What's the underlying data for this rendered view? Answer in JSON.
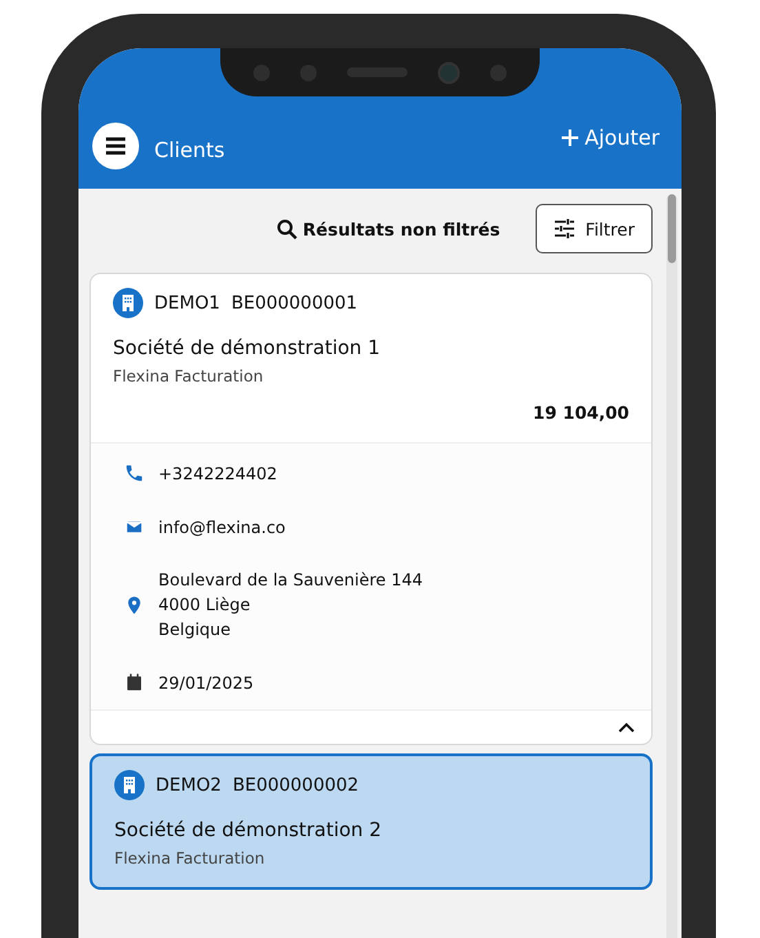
{
  "header": {
    "title": "Clients",
    "add_label": "Ajouter"
  },
  "toolbar": {
    "filter_status": "Résultats non filtrés",
    "filter_button": "Filtrer"
  },
  "clients": [
    {
      "code": "DEMO1",
      "vat": "BE000000001",
      "name": "Société de démonstration 1",
      "company": "Flexina Facturation",
      "amount": "19 104,00",
      "selected": false,
      "expanded": true,
      "details": [
        {
          "kind": "phone",
          "lines": [
            "+3242224402"
          ]
        },
        {
          "kind": "email",
          "lines": [
            "info@flexina.co"
          ]
        },
        {
          "kind": "address",
          "lines": [
            "Boulevard de la Sauvenière 144",
            "4000 Liège",
            "Belgique"
          ]
        },
        {
          "kind": "date",
          "lines": [
            "29/01/2025"
          ]
        }
      ]
    },
    {
      "code": "DEMO2",
      "vat": "BE000000002",
      "name": "Société de démonstration 2",
      "company": "Flexina Facturation",
      "selected": true,
      "expanded": false
    }
  ]
}
